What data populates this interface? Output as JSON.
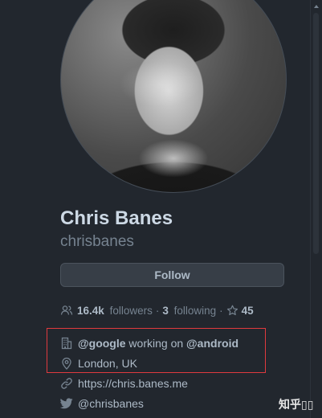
{
  "profile": {
    "name": "Chris Banes",
    "username": "chrisbanes",
    "follow_label": "Follow"
  },
  "stats": {
    "followers_count": "16.4k",
    "followers_label": "followers",
    "following_count": "3",
    "following_label": "following",
    "stars_count": "45"
  },
  "bio": {
    "org_mention": "@google",
    "middle_text": " working on ",
    "project_mention": "@android",
    "location": "London, UK",
    "website": "https://chris.banes.me",
    "twitter": "@chrisbanes"
  },
  "watermark": "知乎▯▯",
  "colors": {
    "background": "#22272e",
    "highlight_border": "#e03a3e"
  }
}
